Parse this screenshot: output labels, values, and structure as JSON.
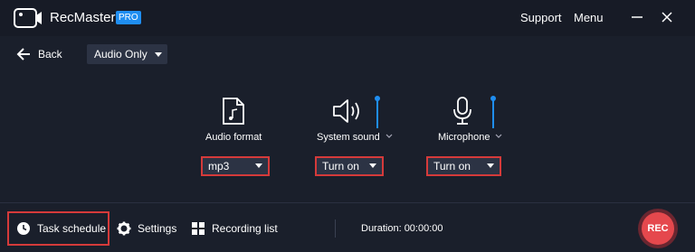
{
  "app": {
    "name": "RecMaster",
    "badge": "PRO"
  },
  "titlebar": {
    "support": "Support",
    "menu": "Menu"
  },
  "toolbar": {
    "back_label": "Back",
    "mode_selected": "Audio Only"
  },
  "audio_format": {
    "label": "Audio format",
    "selected": "mp3"
  },
  "system_sound": {
    "label": "System sound",
    "selected": "Turn on",
    "volume_fraction": 1.0
  },
  "microphone": {
    "label": "Microphone",
    "selected": "Turn on",
    "volume_fraction": 1.0
  },
  "bottom": {
    "task_schedule": "Task schedule",
    "settings": "Settings",
    "recording_list": "Recording list",
    "duration": "Duration: 00:00:00",
    "rec": "REC"
  },
  "colors": {
    "accent": "#1f8ef1",
    "highlight": "#d53a3a",
    "rec": "#e5484d",
    "background": "#1a1f2b"
  }
}
